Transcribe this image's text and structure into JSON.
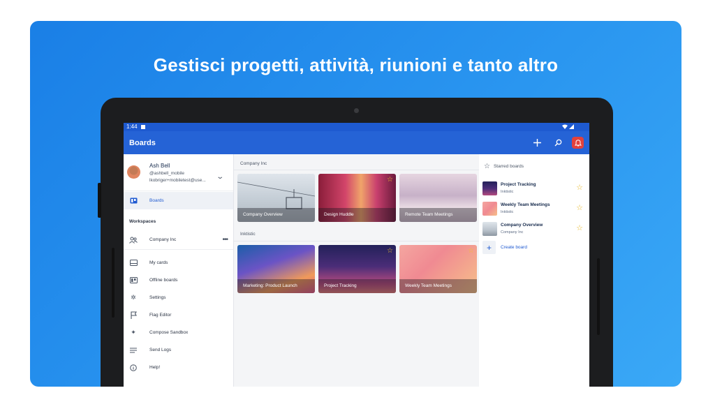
{
  "headline": "Gestisci progetti, attività, riunioni e tanto altro",
  "status_bar": {
    "time": "1:44"
  },
  "app_bar": {
    "title": "Boards",
    "add_icon": "plus-icon",
    "search_icon": "search-icon",
    "notif_icon": "bell-icon"
  },
  "profile": {
    "name": "Ash Bell",
    "handle": "@ashbell_mobile",
    "email": "lkobriger+mobiletest@use..."
  },
  "sidebar": {
    "boards_label": "Boards",
    "workspaces_heading": "Workspaces",
    "workspace_name": "Company Inc",
    "workspace_more": "•••",
    "items": [
      {
        "label": "My cards",
        "icon": "card-icon"
      },
      {
        "label": "Offline boards",
        "icon": "offline-board-icon"
      },
      {
        "label": "Settings",
        "icon": "gear-icon"
      },
      {
        "label": "Flag Editor",
        "icon": "flag-icon"
      },
      {
        "label": "Compose Sandbox",
        "icon": "sparkle-icon"
      },
      {
        "label": "Send Logs",
        "icon": "lines-icon"
      },
      {
        "label": "Help!",
        "icon": "info-icon"
      }
    ]
  },
  "main": {
    "sections": [
      {
        "name": "Company Inc",
        "boards": [
          {
            "title": "Company Overview",
            "starred": false
          },
          {
            "title": "Design Huddle",
            "starred": true
          },
          {
            "title": "Remote Team Meetings",
            "starred": false
          }
        ]
      },
      {
        "name": "Inktistic",
        "boards": [
          {
            "title": "Marketing: Product Launch",
            "starred": false
          },
          {
            "title": "Project Tracking",
            "starred": true
          },
          {
            "title": "Weekly Team Meetings",
            "starred": true
          }
        ]
      }
    ]
  },
  "starred": {
    "heading": "Starred boards",
    "items": [
      {
        "title": "Project Tracking",
        "workspace": "Inktistic"
      },
      {
        "title": "Weekly Team Meetings",
        "workspace": "Inktistic"
      },
      {
        "title": "Company Overview",
        "workspace": "Company Inc"
      }
    ],
    "create_label": "Create board"
  },
  "colors": {
    "banner": "#2a96f0",
    "appbar": "#2563d6",
    "accent": "#1f5ad1",
    "star": "#f2c230",
    "bell": "#e2413c"
  }
}
